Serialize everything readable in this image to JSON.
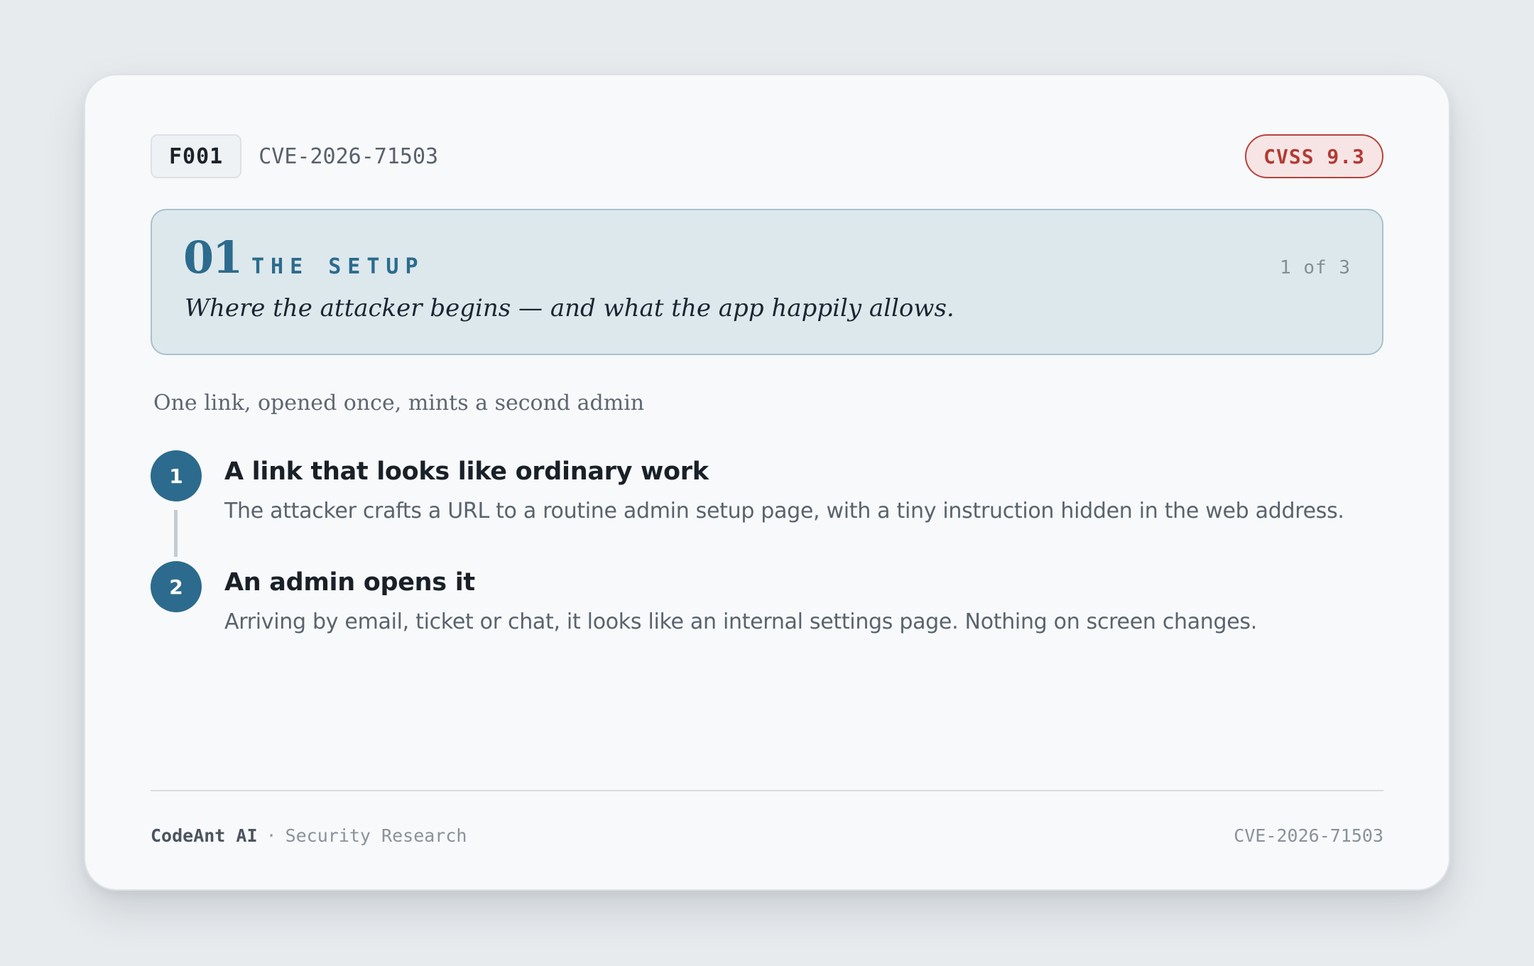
{
  "header": {
    "finding_id": "F001",
    "cve": "CVE-2026-71503",
    "cvss_badge": "CVSS 9.3"
  },
  "stage": {
    "number": "01",
    "label": "THE SETUP",
    "progress": "1 of 3",
    "subtitle": "Where the attacker begins — and what the app happily allows."
  },
  "section_title": "One link, opened once, mints a second admin",
  "steps": [
    {
      "number": "1",
      "title": "A link that looks like ordinary work",
      "description": "The attacker crafts a URL to a routine admin setup page, with a tiny instruction hidden in the web address."
    },
    {
      "number": "2",
      "title": "An admin opens it",
      "description": "Arriving by email, ticket or chat, it looks like an internal settings page. Nothing on screen changes."
    }
  ],
  "footer": {
    "brand": "CodeAnt AI",
    "separator": "·",
    "department": "Security Research",
    "cve": "CVE-2026-71503"
  },
  "colors": {
    "accent": "#2c6b8d",
    "danger": "#b23b35",
    "stage_bg": "#dde8ed",
    "card_bg": "#f7f9fa"
  }
}
